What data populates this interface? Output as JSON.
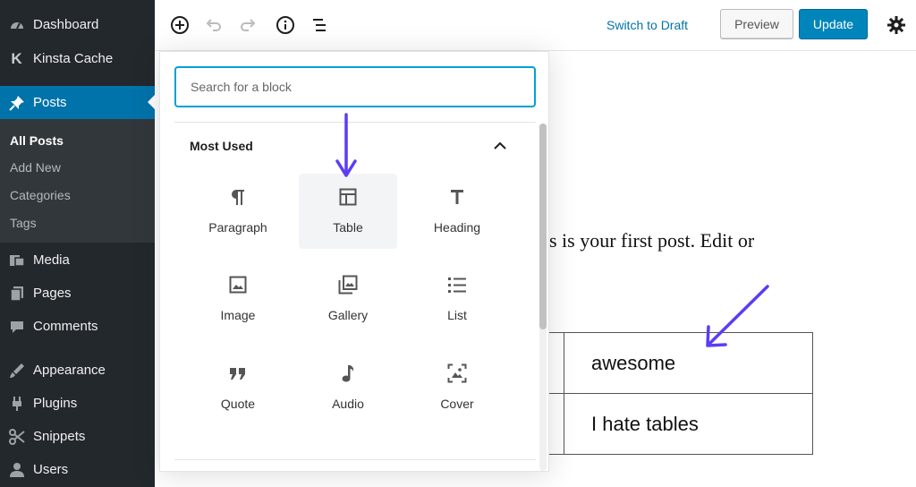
{
  "sidebar": {
    "items": [
      {
        "label": "Dashboard",
        "icon": "dashboard-icon"
      },
      {
        "label": "Kinsta Cache",
        "icon": "kinsta-icon"
      },
      {
        "label": "Posts",
        "icon": "pin-icon",
        "active": true
      },
      {
        "label": "Media",
        "icon": "media-icon"
      },
      {
        "label": "Pages",
        "icon": "pages-icon"
      },
      {
        "label": "Comments",
        "icon": "comments-icon"
      },
      {
        "label": "Appearance",
        "icon": "appearance-icon"
      },
      {
        "label": "Plugins",
        "icon": "plugins-icon"
      },
      {
        "label": "Snippets",
        "icon": "snippets-icon"
      },
      {
        "label": "Users",
        "icon": "users-icon"
      }
    ],
    "submenu": [
      "All Posts",
      "Add New",
      "Categories",
      "Tags"
    ]
  },
  "toolbar": {
    "switch_to_draft": "Switch to Draft",
    "preview_label": "Preview",
    "update_label": "Update"
  },
  "inserter": {
    "search_placeholder": "Search for a block",
    "panel_title": "Most Used",
    "blocks": [
      {
        "label": "Paragraph",
        "icon": "paragraph-icon"
      },
      {
        "label": "Table",
        "icon": "table-icon"
      },
      {
        "label": "Heading",
        "icon": "heading-icon"
      },
      {
        "label": "Image",
        "icon": "image-icon"
      },
      {
        "label": "Gallery",
        "icon": "gallery-icon"
      },
      {
        "label": "List",
        "icon": "list-icon"
      },
      {
        "label": "Quote",
        "icon": "quote-icon"
      },
      {
        "label": "Audio",
        "icon": "audio-icon"
      },
      {
        "label": "Cover",
        "icon": "cover-icon"
      }
    ]
  },
  "content": {
    "post_text": "s is your first post. Edit or",
    "table_rows": [
      "awesome",
      "I hate tables"
    ]
  },
  "colors": {
    "sidebar_bg": "#23282d",
    "active_bg": "#0073aa",
    "link": "#0073aa",
    "update_button": "#0085ba",
    "annotation_arrow": "#5b3df5"
  }
}
